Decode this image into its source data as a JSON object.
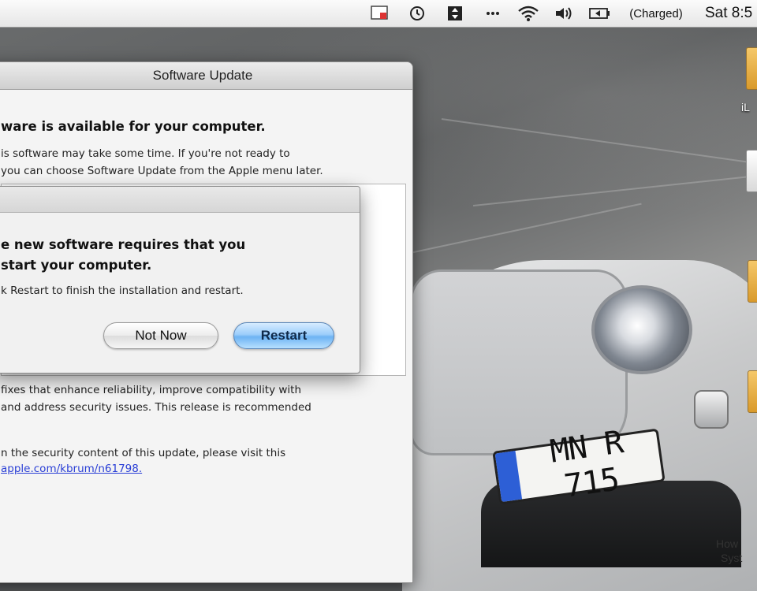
{
  "menubar": {
    "battery_status": "(Charged)",
    "clock": "Sat 8:5",
    "icons": [
      "software-update-icon",
      "time-machine-icon",
      "sync-icon",
      "bluetooth-icon",
      "wifi-icon",
      "volume-icon",
      "battery-icon"
    ]
  },
  "desktop": {
    "plate_text": "MN R 715",
    "icon_labels": [
      "iL",
      "How",
      "Syst"
    ]
  },
  "software_update": {
    "title": "Software Update",
    "heading": "ware is available for your computer.",
    "body_lines": [
      "is software may take some time. If you're not ready to",
      "you can choose Software Update from the Apple menu later."
    ],
    "description_lines": [
      "fixes that enhance reliability, improve compatibility with",
      "and address security issues. This release is recommended"
    ],
    "security_line": "n the security content of this update, please visit this",
    "link": "apple.com/kbrum/n61798."
  },
  "restart_sheet": {
    "heading_line1": "e new software requires that you",
    "heading_line2": "start your computer.",
    "message": "k Restart to finish the installation and restart.",
    "not_now_label": "Not Now",
    "restart_label": "Restart"
  },
  "colors": {
    "restart_button": "#7fbdf5",
    "link": "#2a3fd6",
    "plate_eu_band": "#2d5fd6"
  }
}
